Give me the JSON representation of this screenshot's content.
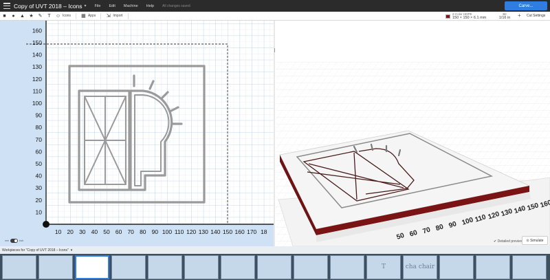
{
  "app": {
    "title": "Copy of UVT 2018 – Icons",
    "menus": [
      "File",
      "Edit",
      "Machine",
      "Help"
    ],
    "save_status": "All changes saved",
    "carve_button": "Carve..."
  },
  "toolbar": {
    "tools": [
      {
        "icon": "square-icon",
        "glyph": "■"
      },
      {
        "icon": "circle-icon",
        "glyph": "●"
      },
      {
        "icon": "triangle-icon",
        "glyph": "▲"
      },
      {
        "icon": "star-icon",
        "glyph": "★"
      },
      {
        "icon": "pen-icon",
        "glyph": "✎"
      },
      {
        "icon": "text-icon",
        "glyph": "T"
      }
    ],
    "icons_label": "Icons",
    "apps_label": "Apps",
    "import_label": "Import",
    "material_label": "2-Color HDPE",
    "material_dims": "150 × 150 × 6.1 mm",
    "bit_label": "Bit",
    "bit_value": "1/16 in",
    "cut_settings": "Cut Settings"
  },
  "canvas2d": {
    "y_ticks": [
      "10",
      "20",
      "30",
      "40",
      "50",
      "60",
      "70",
      "80",
      "90",
      "100",
      "110",
      "120",
      "130",
      "140",
      "150",
      "160"
    ],
    "x_ticks": [
      "10",
      "20",
      "30",
      "40",
      "50",
      "60",
      "70",
      "80",
      "90",
      "100",
      "110",
      "120",
      "130",
      "140",
      "150",
      "160",
      "170",
      "18"
    ],
    "toggle_left": "mm",
    "toggle_right": "inch"
  },
  "canvas3d": {
    "ruler_ticks": [
      "50",
      "60",
      "70",
      "80",
      "90",
      "100",
      "110",
      "120",
      "130",
      "140",
      "150",
      "160"
    ],
    "detailed_preview": "Detailed preview",
    "simulate": "Simulate"
  },
  "workpieces": {
    "header": "Workpieces for \"Copy of UVT 2018 – Icons\"",
    "caret": "▾",
    "items": [
      {
        "label": ""
      },
      {
        "label": ""
      },
      {
        "label": ""
      },
      {
        "label": ""
      },
      {
        "label": ""
      },
      {
        "label": ""
      },
      {
        "label": ""
      },
      {
        "label": ""
      },
      {
        "label": ""
      },
      {
        "label": ""
      },
      {
        "label": "T"
      },
      {
        "label": "cha chair"
      },
      {
        "label": ""
      },
      {
        "label": ""
      },
      {
        "label": ""
      }
    ],
    "active_index": 2
  }
}
